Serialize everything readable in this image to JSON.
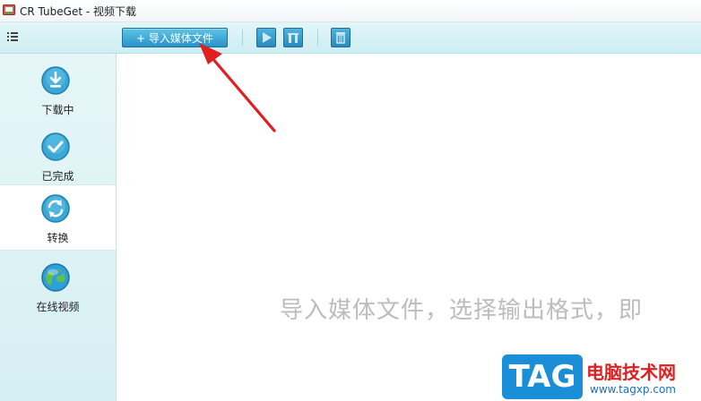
{
  "window": {
    "title": "CR TubeGet - 视频下载"
  },
  "toolbar": {
    "import_label": "+ 导入媒体文件",
    "icons": [
      "menu-icon",
      "play-icon",
      "pause-icon",
      "delete-icon"
    ]
  },
  "sidebar": {
    "items": [
      {
        "label": "下载中",
        "icon": "download-icon"
      },
      {
        "label": "已完成",
        "icon": "check-icon"
      },
      {
        "label": "转换",
        "icon": "convert-icon"
      },
      {
        "label": "在线视频",
        "icon": "globe-icon"
      }
    ],
    "active_index": 2
  },
  "main": {
    "hint": "导入媒体文件，选择输出格式，即"
  },
  "watermark": {
    "tag": "TAG",
    "site_name": "电脑技术网",
    "url": "www.tagxp.com"
  },
  "colors": {
    "accent": "#2a93c8",
    "sidebar_bg": "#e6f6f8",
    "toolbar_bg": "#d8f1f5",
    "hint_text": "#bcbcbc",
    "annotation_arrow": "#e02020",
    "watermark_blue": "#1a8fd8",
    "watermark_red": "#e02020"
  }
}
